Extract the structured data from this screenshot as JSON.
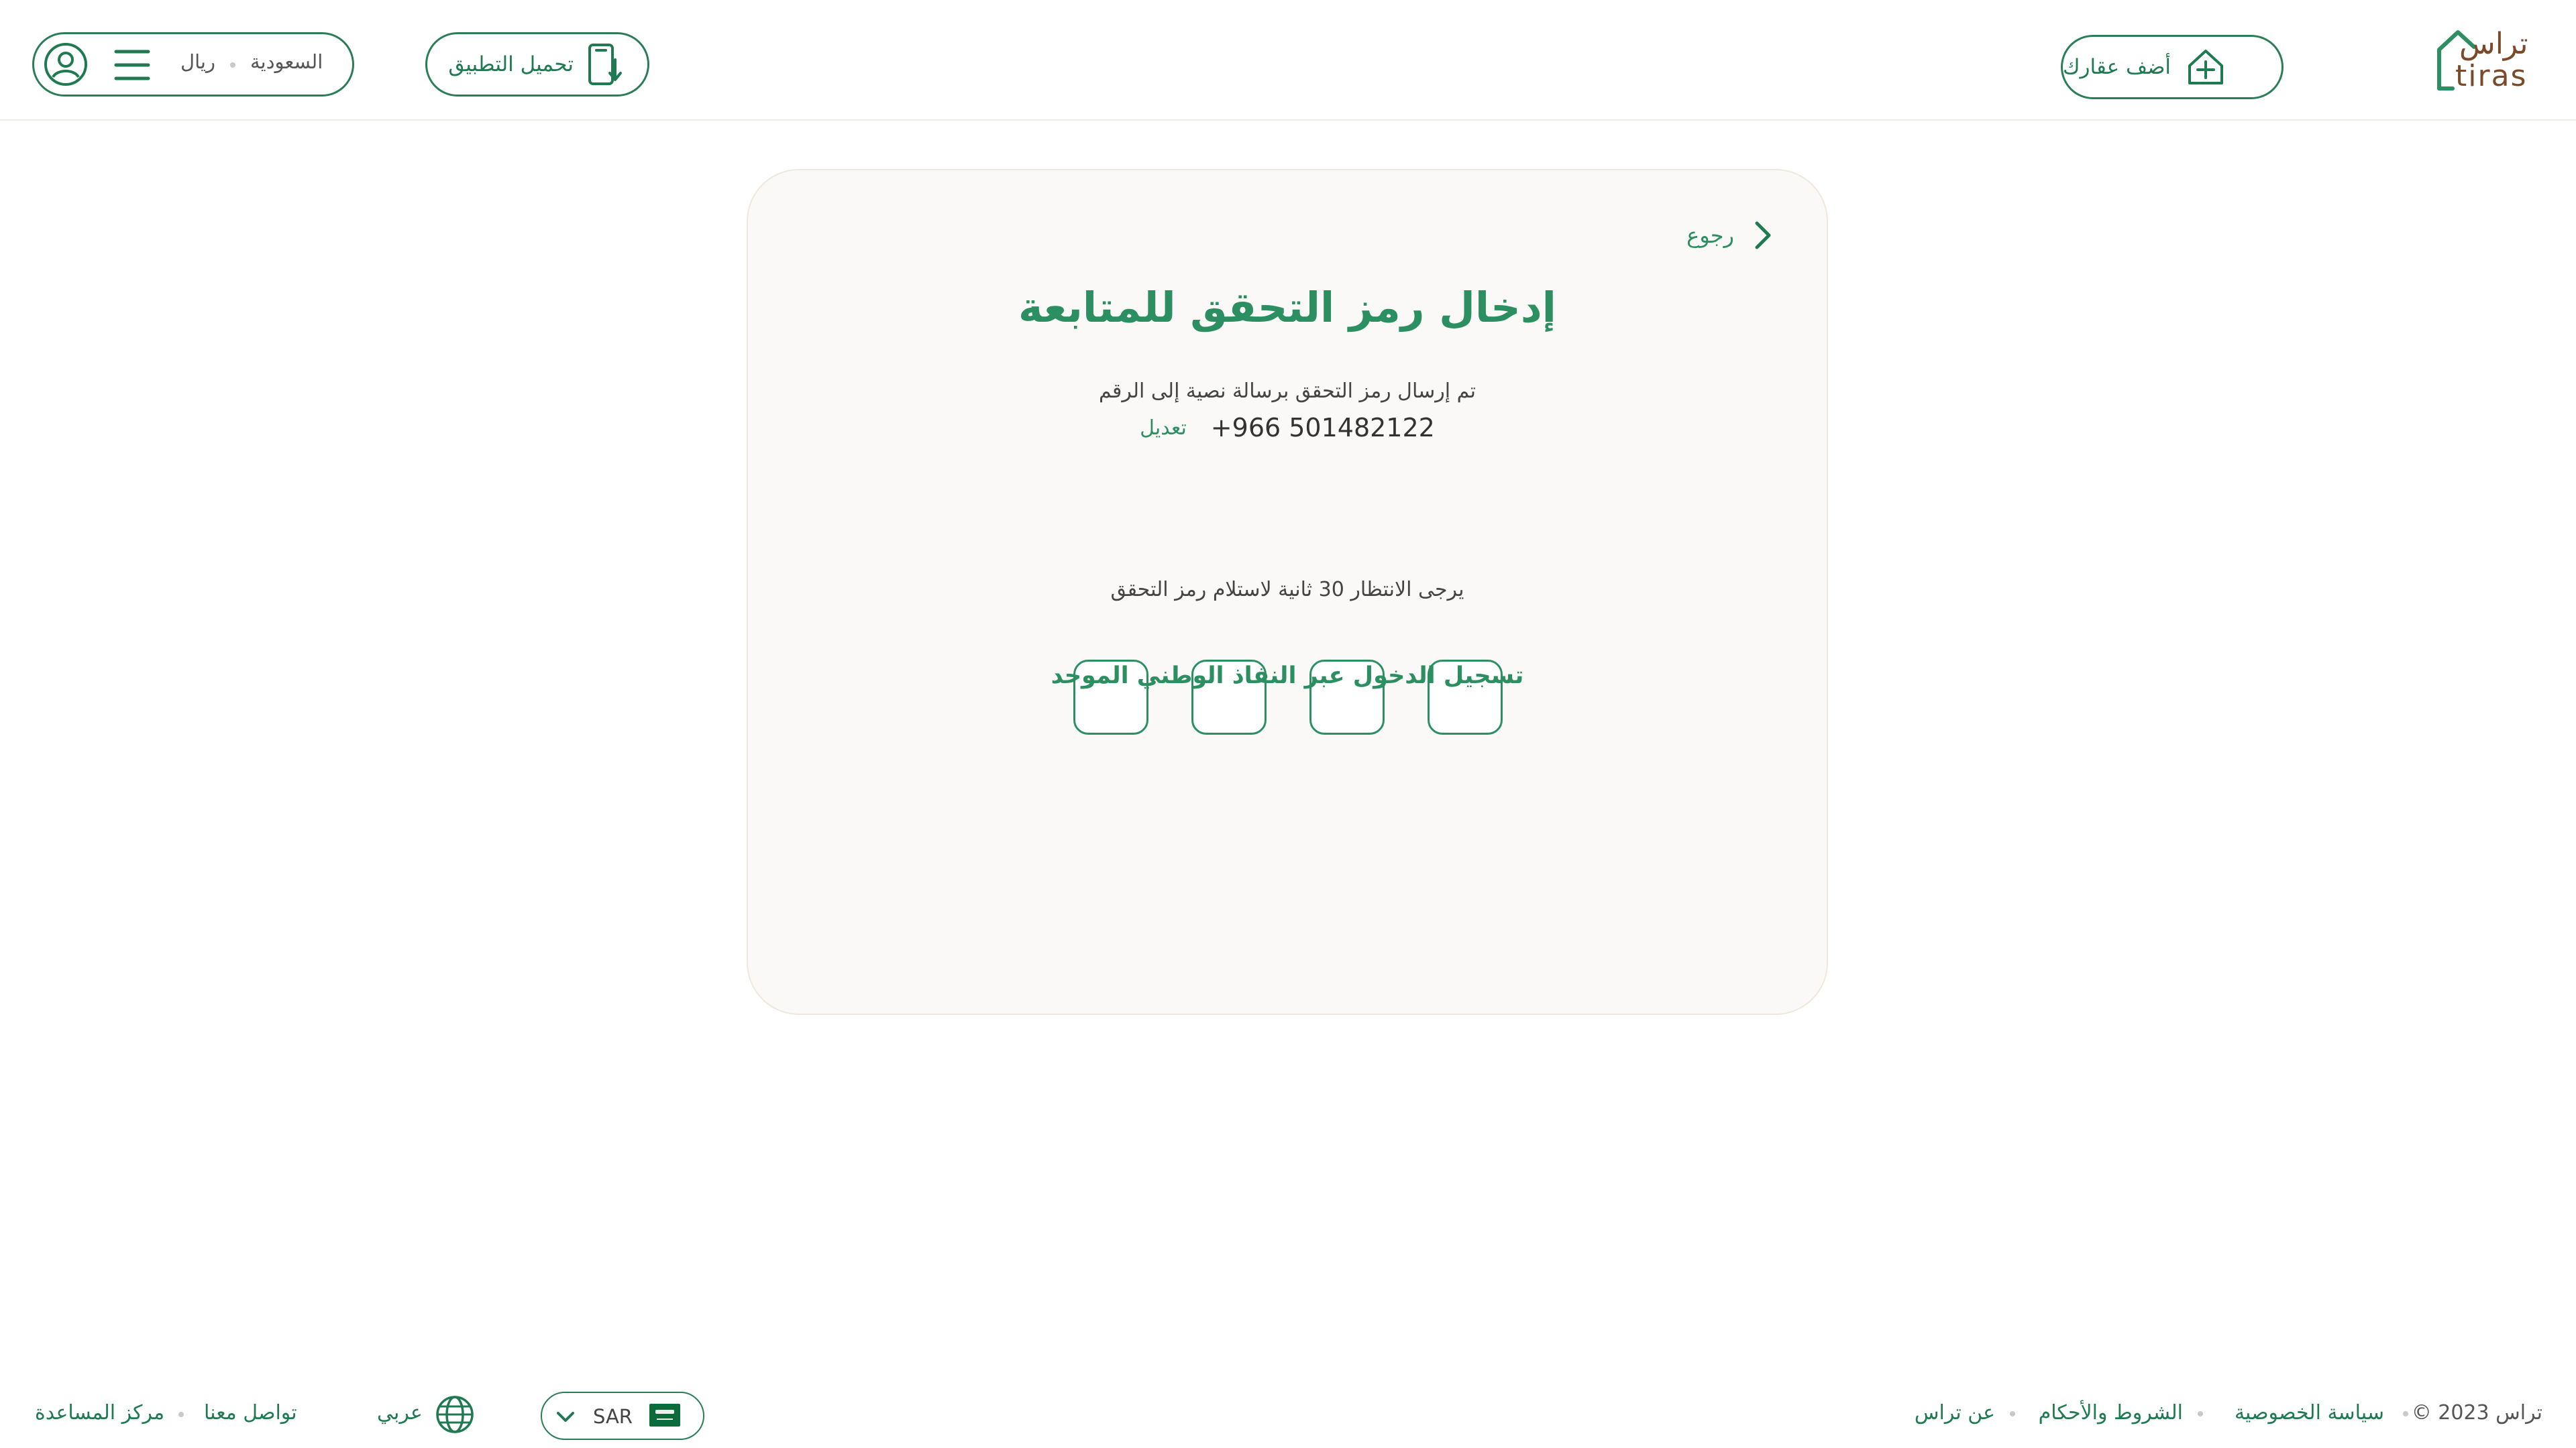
{
  "header": {
    "logo_ar": "تراس",
    "logo_en": "tiras",
    "add_property": "أضف عقارك",
    "download_app": "تحميل التطبيق",
    "country": "السعودية",
    "currency": "ريال"
  },
  "card": {
    "back": "رجوع",
    "title": "إدخال رمز التحقق للمتابعة",
    "sent_msg": "تم إرسال رمز التحقق برسالة نصية إلى الرقم",
    "phone": "+966 501482122",
    "edit": "تعديل",
    "otp_values": [
      "",
      "",
      "",
      ""
    ],
    "wait_msg": "يرجى الانتظار 30 ثانية لاستلام رمز التحقق",
    "nafath": "تسجيل الدخول عبر النفاذ الوطني الموحد"
  },
  "footer": {
    "copyright": "© 2023 تراس",
    "links": [
      "سياسة الخصوصية",
      "الشروط والأحكام",
      "عن تراس"
    ],
    "currency_code": "SAR",
    "language": "عربي",
    "help_links": [
      "تواصل معنا",
      "مركز المساعدة"
    ]
  },
  "colors": {
    "brand_green": "#1f7a52",
    "title_green": "#2b8f62",
    "brand_brown": "#7a4a2a",
    "card_bg": "#faf9f7"
  },
  "icons": [
    "house-plus-icon",
    "phone-download-icon",
    "menu-icon",
    "user-icon",
    "chevron-right-icon",
    "globe-icon",
    "saudi-flag-icon",
    "chevron-down-icon"
  ]
}
